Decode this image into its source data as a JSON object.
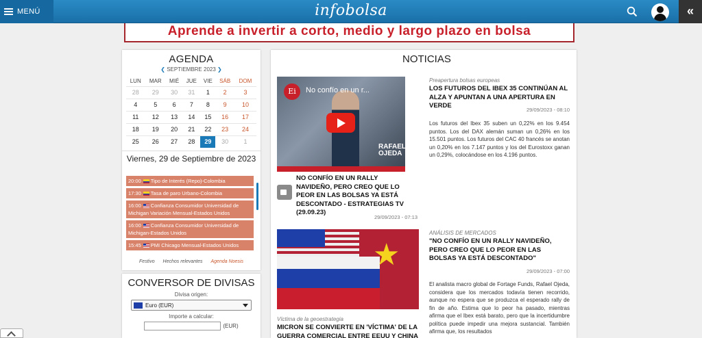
{
  "header": {
    "menu_label": "MENÚ",
    "logo": "infobolsa",
    "collapse_label": "«"
  },
  "banner": {
    "text": "Aprende a invertir a corto, medio y largo plazo en bolsa"
  },
  "agenda": {
    "title": "AGENDA",
    "month": "SEPTIEMBRE 2023",
    "weekdays": [
      "LUN",
      "MAR",
      "MIÉ",
      "JUE",
      "VIE",
      "SÁB",
      "DOM"
    ],
    "weeks": [
      [
        "28",
        "29",
        "30",
        "31",
        "1",
        "2",
        "3"
      ],
      [
        "4",
        "5",
        "6",
        "7",
        "8",
        "9",
        "10"
      ],
      [
        "11",
        "12",
        "13",
        "14",
        "15",
        "16",
        "17"
      ],
      [
        "18",
        "19",
        "20",
        "21",
        "22",
        "23",
        "24"
      ],
      [
        "25",
        "26",
        "27",
        "28",
        "29",
        "30",
        "1"
      ]
    ],
    "selected_day": "29",
    "day_title": "Viernes, 29 de Septiembre de 2023",
    "events": [
      {
        "time": "20:00",
        "country": "co",
        "text": "Tipo de Interés (Repo)-Colombia"
      },
      {
        "time": "17:30",
        "country": "co",
        "text": "Tasa de paro Urbano-Colombia"
      },
      {
        "time": "16:00",
        "country": "us",
        "text": "Confianza Consumidor Universidad de Michigan Variación Mensual-Estados Unidos"
      },
      {
        "time": "16:00",
        "country": "us",
        "text": "Confianza Consumidor Universidad de Michigan-Estados Unidos"
      },
      {
        "time": "15:45",
        "country": "us",
        "text": "PMI Chicago Mensual-Estados Unidos"
      }
    ],
    "legend": [
      "Festivo",
      "Hechos relevantes",
      "Agenda Noesis"
    ]
  },
  "converter": {
    "title": "CONVERSOR DE DIVISAS",
    "origin_label": "Divisa origen:",
    "origin_value": "Euro (EUR)",
    "amount_label": "Importe a calcular:",
    "amount_value": "",
    "amount_unit": "(EUR)"
  },
  "news": {
    "title": "NOTICIAS",
    "video": {
      "logo": "Ei",
      "caption": "No confío en un r...",
      "name1": "RAFAEL",
      "name2": "OJEDA"
    },
    "video_article": {
      "title": "NO CONFÍO EN UN RALLY NAVIDEÑO, PERO CREO QUE LO PEOR EN LAS BOLSAS YA ESTÁ DESCONTADO - ESTRATEGIAS TV (29.09.23)",
      "date": "29/09/2023 - 07:13"
    },
    "article1": {
      "category": "Preapertura bolsas europeas",
      "title": "LOS FUTUROS DEL IBEX 35 CONTINÚAN AL ALZA Y APUNTAN A UNA APERTURA EN VERDE",
      "date": "29/09/2023 - 08:10",
      "text": "Los futuros del Ibex 35 suben un 0,22% en los 9.454 puntos. Los del DAX alemán suman un 0,26% en los 15.501 puntos. Los futuros del CAC 40 francés se anotan un 0,20% en los 7.147 puntos y los del Eurostoxx ganan un 0,29%, colocándose en los 4.196 puntos."
    },
    "article2": {
      "category": "ANÁLISIS DE MERCADOS",
      "title": "\"NO CONFÍO EN UN RALLY NAVIDEÑO, PERO CREO QUE LO PEOR EN LAS BOLSAS YA ESTÁ DESCONTADO\"",
      "date": "29/09/2023 - 07:00",
      "text": "El analista macro global de Fortage Funds, Rafael Ojeda, considera que los mercados todavía tienen recorrido, aunque no espera que se produzca el esperado rally de fin de año. Estima que lo peor ha pasado, mientras afirma que el Ibex está barato, pero que la incertidumbre política puede impedir una mejora sustancial. También afirma que, los resultados"
    },
    "article3": {
      "category": "Víctima de la geoestrategia",
      "title": "MICRON SE CONVIERTE EN 'VÍCTIMA' DE LA GUERRA COMERCIAL ENTRE EEUU Y CHINA"
    }
  }
}
